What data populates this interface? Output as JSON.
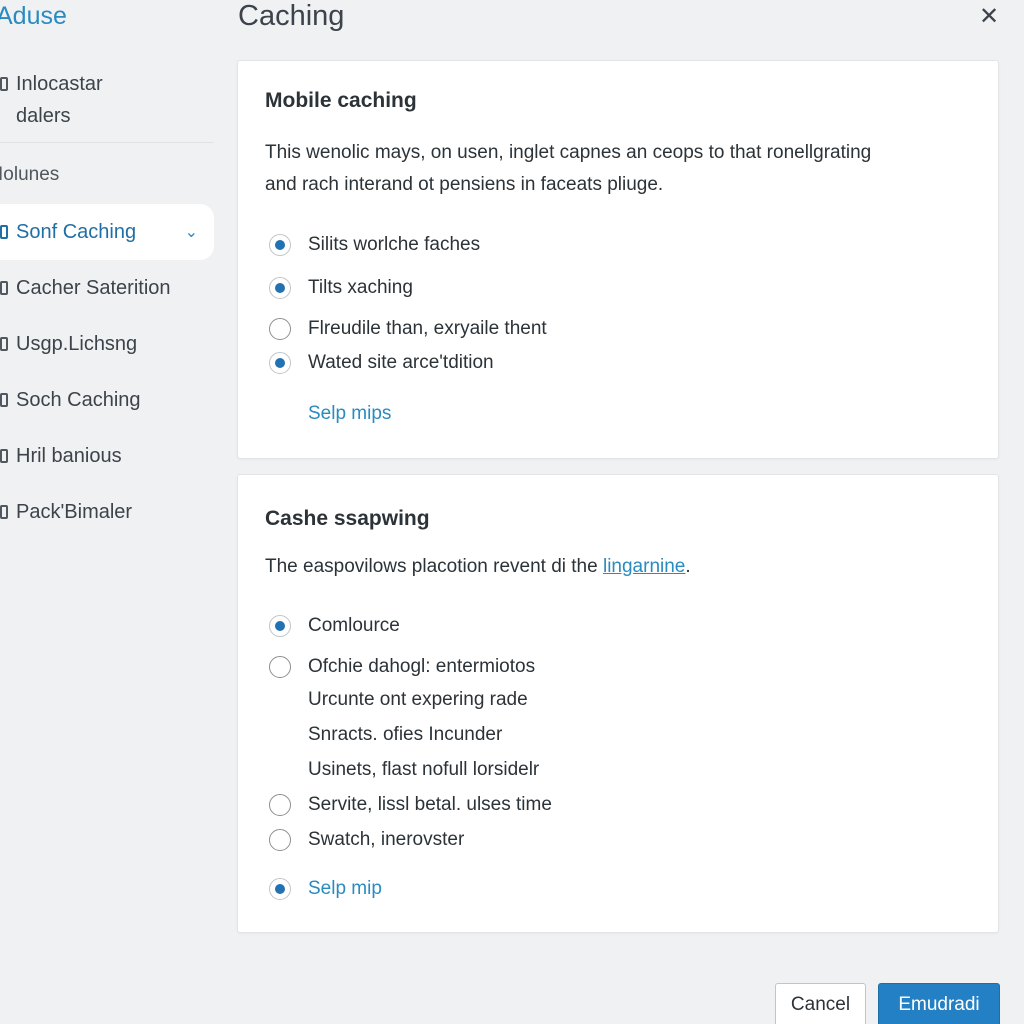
{
  "app": {
    "brand": "Aduse",
    "title": "Caching"
  },
  "sidebar": {
    "head_line1": "Inlocastar",
    "head_line2": "dalers",
    "group_label": "Iolunes",
    "items": [
      {
        "label": "Sonf Caching",
        "active": true
      },
      {
        "label": "Cacher Saterition"
      },
      {
        "label": "Usgp.Lichsng"
      },
      {
        "label": "Soch Caching"
      },
      {
        "label": "Hril banious"
      },
      {
        "label": "Pack'Bimaler"
      }
    ]
  },
  "card1": {
    "title": "Mobile caching",
    "desc_line1": "This wenolic mays, on usen, inglet capnes an ceops to that ronellgrating",
    "desc_line2": "and rach interand ot pensiens in faceats pliuge.",
    "options": [
      {
        "label": "Silits worlche faches",
        "checked": true
      },
      {
        "label": "Tilts xaching",
        "checked": true
      },
      {
        "label": "Flreudile than, exryaile thent",
        "checked": false
      },
      {
        "label": "Wated site arce'tdition",
        "checked": true
      }
    ],
    "link": "Selp mips"
  },
  "card2": {
    "title": "Cashe ssapwing",
    "desc_text": "The easpovilows placotion revent di the ",
    "desc_link": "lingarnine",
    "desc_end": ".",
    "options": [
      {
        "label": "Comlource",
        "checked": true
      },
      {
        "label": "Ofchie dahogl: entermiotos",
        "checked": false
      },
      {
        "label": "Servite, lissl betal. ulses time",
        "checked": false
      },
      {
        "label": "Swatch, inerovster",
        "checked": false
      },
      {
        "label": "Selp mip",
        "checked": true
      }
    ],
    "sub_lines": [
      "Urcunte ont expering rade",
      "Snracts. ofies Incunder",
      "Usinets, flast nofull lorsidelr"
    ]
  },
  "footer": {
    "cancel": "Cancel",
    "primary": "Emudradi"
  },
  "colors": {
    "accent": "#2271b1",
    "link": "#2a8bc0",
    "primary_button": "#2380c4",
    "background": "#f0f1f3"
  }
}
